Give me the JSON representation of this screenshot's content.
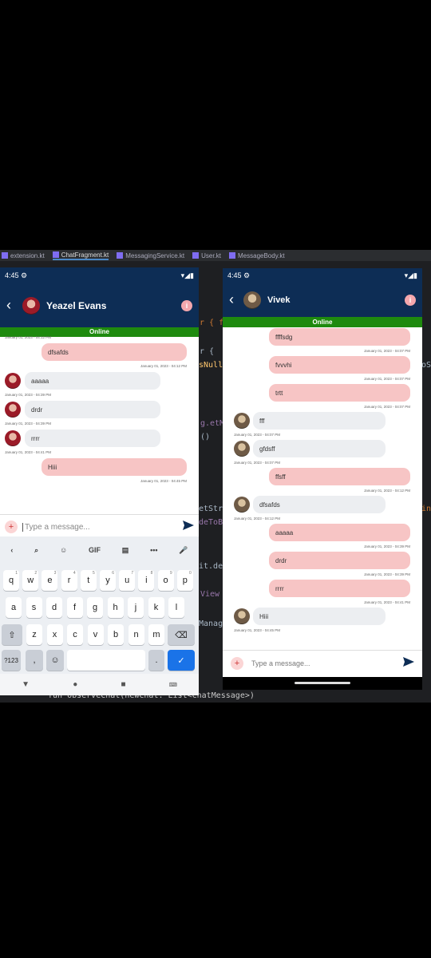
{
  "ide": {
    "tabs": [
      "extension.kt",
      "ChatFragment.kt",
      "MessagingService.kt",
      "User.kt",
      "MessageBody.kt"
    ],
    "code": [
      {
        "t": "r { f",
        "c": "o"
      },
      {
        "t": "r {",
        "c": ""
      },
      {
        "t": "sNull",
        "c": "y"
      },
      {
        "t": "g.etM",
        "c": "v"
      },
      {
        "t": "()",
        "c": ""
      },
      {
        "t": "etStr",
        "c": ""
      },
      {
        "t": "deToB",
        "c": "v"
      },
      {
        "t": "it.de",
        "c": ""
      },
      {
        "t": "View",
        "c": "v"
      },
      {
        "t": "Manag",
        "c": ""
      },
      {
        "t": "oS",
        "c": ""
      },
      {
        "t": "in",
        "c": "o"
      }
    ],
    "bottom_code": "fun observeChat(newChat: List<ChatMessage>)"
  },
  "phone1": {
    "time": "4:45",
    "contact_name": "Yeazel Evans",
    "status": "Online",
    "info_icon": "i",
    "messages": [
      {
        "dir": "top_ts",
        "ts": "January 01, 2023 - 04:12 PM"
      },
      {
        "dir": "out",
        "text": "dfsafds",
        "ts": "January 01, 2023 - 04:12 PM"
      },
      {
        "dir": "in",
        "text": "aaaaa",
        "ts": "January 01, 2023 - 04:39 PM"
      },
      {
        "dir": "in",
        "text": "drdr",
        "ts": "January 01, 2023 - 04:39 PM"
      },
      {
        "dir": "in",
        "text": "rrrr",
        "ts": "January 01, 2023 - 04:41 PM"
      },
      {
        "dir": "out",
        "text": "Hiii",
        "ts": "January 01, 2023 - 04:45 PM"
      }
    ],
    "input_placeholder": "Type a message...",
    "keyboard": {
      "toolbar": [
        "‹",
        "⌕",
        "☺",
        "GIF",
        "▤",
        "•••",
        "🎤"
      ],
      "row1": [
        [
          "q",
          "1"
        ],
        [
          "w",
          "2"
        ],
        [
          "e",
          "3"
        ],
        [
          "r",
          "4"
        ],
        [
          "t",
          "5"
        ],
        [
          "y",
          "6"
        ],
        [
          "u",
          "7"
        ],
        [
          "i",
          "8"
        ],
        [
          "o",
          "9"
        ],
        [
          "p",
          "0"
        ]
      ],
      "row2": [
        "a",
        "s",
        "d",
        "f",
        "g",
        "h",
        "j",
        "k",
        "l"
      ],
      "row3": [
        "z",
        "x",
        "c",
        "v",
        "b",
        "n",
        "m"
      ],
      "symbols": "?123",
      "comma": ",",
      "period": "."
    }
  },
  "phone2": {
    "time": "4:45",
    "contact_name": "Vivek",
    "status": "Online",
    "info_icon": "i",
    "messages": [
      {
        "dir": "out",
        "text": "ffffsdg",
        "ts": "January 01, 2023 - 04:07 PM"
      },
      {
        "dir": "out",
        "text": "fvvvhi",
        "ts": "January 01, 2023 - 04:07 PM"
      },
      {
        "dir": "out",
        "text": "trtt",
        "ts": "January 01, 2023 - 04:07 PM"
      },
      {
        "dir": "in",
        "text": "fff",
        "ts": "January 01, 2023 - 04:07 PM"
      },
      {
        "dir": "in",
        "text": "gfdsff",
        "ts": "January 01, 2023 - 04:07 PM"
      },
      {
        "dir": "out",
        "text": "ffsff",
        "ts": "January 01, 2023 - 04:12 PM"
      },
      {
        "dir": "in",
        "text": "dfsafds",
        "ts": "January 01, 2023 - 04:12 PM"
      },
      {
        "dir": "out",
        "text": "aaaaa",
        "ts": "January 01, 2023 - 04:39 PM"
      },
      {
        "dir": "out",
        "text": "drdr",
        "ts": "January 01, 2023 - 04:39 PM"
      },
      {
        "dir": "out",
        "text": "rrrr",
        "ts": "January 01, 2023 - 04:41 PM"
      },
      {
        "dir": "in",
        "text": "Hiii",
        "ts": "January 01, 2023 - 04:45 PM"
      }
    ],
    "input_placeholder": "Type a message..."
  },
  "colors": {
    "appbar": "#0d2d55",
    "online": "#1e8a0e",
    "bubble_out": "#f7c5c5",
    "bubble_in": "#eceef1"
  }
}
